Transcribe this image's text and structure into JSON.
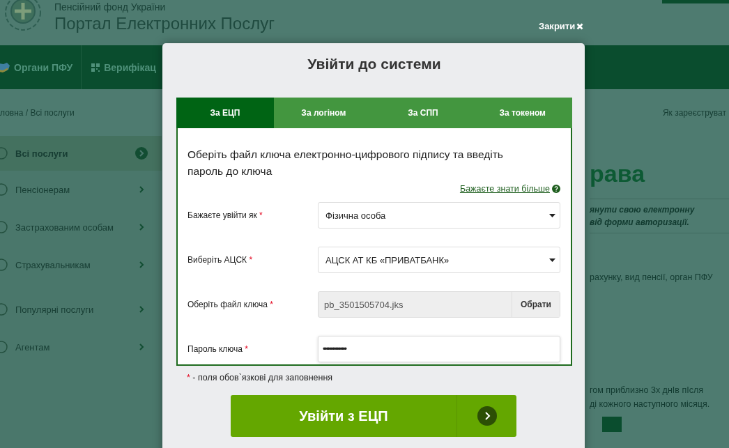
{
  "header": {
    "org_name": "Пенсійний фонд України",
    "title": "Портал Електронних Послуг"
  },
  "nav": [
    {
      "label": "Органи ПФУ"
    },
    {
      "label": "Верифікац"
    }
  ],
  "breadcrumb": "ловна / Всі послуги",
  "top_link": "Як зареєструват",
  "sidebar": {
    "groups": [
      [
        {
          "label": "Всі послуги",
          "selected": true
        },
        {
          "label": "Пенсіонерам",
          "selected": false
        },
        {
          "label": "Застрахованим особам",
          "selected": false
        },
        {
          "label": "Страхувальникам",
          "selected": false
        }
      ],
      [
        {
          "label": "Популярні послуги",
          "selected": false
        },
        {
          "label": "Агентам",
          "selected": false
        }
      ]
    ]
  },
  "content": {
    "heading": "рава",
    "intro": [
      "янути свою електронну",
      "від форми авторизації."
    ],
    "text": "рахунку, вид пенсії, орган ПФУ",
    "note": [
      "гом приблизно 3х днІв пІсля",
      "ді кожного наступного місяця."
    ]
  },
  "modal": {
    "close_label": "Закрити",
    "title": "Увійти до системи",
    "tabs": [
      {
        "label": "За ЕЦП",
        "selected": true
      },
      {
        "label": "За логіном",
        "selected": false
      },
      {
        "label": "За СПП",
        "selected": false
      },
      {
        "label": "За токеном",
        "selected": false
      }
    ],
    "instruction": "Оберіть файл ключа електронно-цифрового підпису та введіть пароль до ключа",
    "help_link": "Бажаєте знати більше",
    "fields": [
      {
        "kind": "select",
        "label": "Бажаєте увійти як",
        "mark": "*",
        "value": "Фізична особа"
      },
      {
        "kind": "select",
        "label": "Виберіть АЦСК",
        "mark": "*",
        "value": "АЦСК АТ КБ «ПРИВАТБАНК»"
      },
      {
        "kind": "file",
        "label": "Оберіть файл ключа",
        "mark": "*",
        "value": "pb_3501505704.jks",
        "button": "Обрати"
      },
      {
        "kind": "password",
        "label": "Пароль ключа",
        "mark": "*",
        "value": "•••••••••••••••"
      }
    ],
    "required_note": {
      "mark": "*",
      "text": "- поля обов`язкові для заповнення"
    },
    "submit": "Увійти з ЕЦП"
  }
}
